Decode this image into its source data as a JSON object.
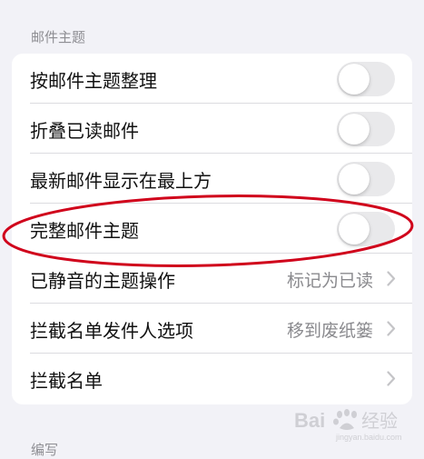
{
  "mail_thread_section": {
    "header": "邮件主题",
    "rows": [
      {
        "label": "按邮件主题整理",
        "toggle_on": false
      },
      {
        "label": "折叠已读邮件",
        "toggle_on": false
      },
      {
        "label": "最新邮件显示在最上方",
        "toggle_on": false
      },
      {
        "label": "完整邮件主题",
        "toggle_on": false
      },
      {
        "label": "已静音的主题操作",
        "value": "标记为已读"
      },
      {
        "label": "拦截名单发件人选项",
        "value": "移到废纸篓"
      },
      {
        "label": "拦截名单"
      }
    ]
  },
  "compose_section": {
    "header": "编写"
  },
  "watermark": {
    "text": "Bai 经验",
    "url_text": "jingyan.baidu.com"
  },
  "colors": {
    "annotation": "#d0021b",
    "background": "#f2f2f7",
    "toggle_off": "#e9e9eb"
  }
}
